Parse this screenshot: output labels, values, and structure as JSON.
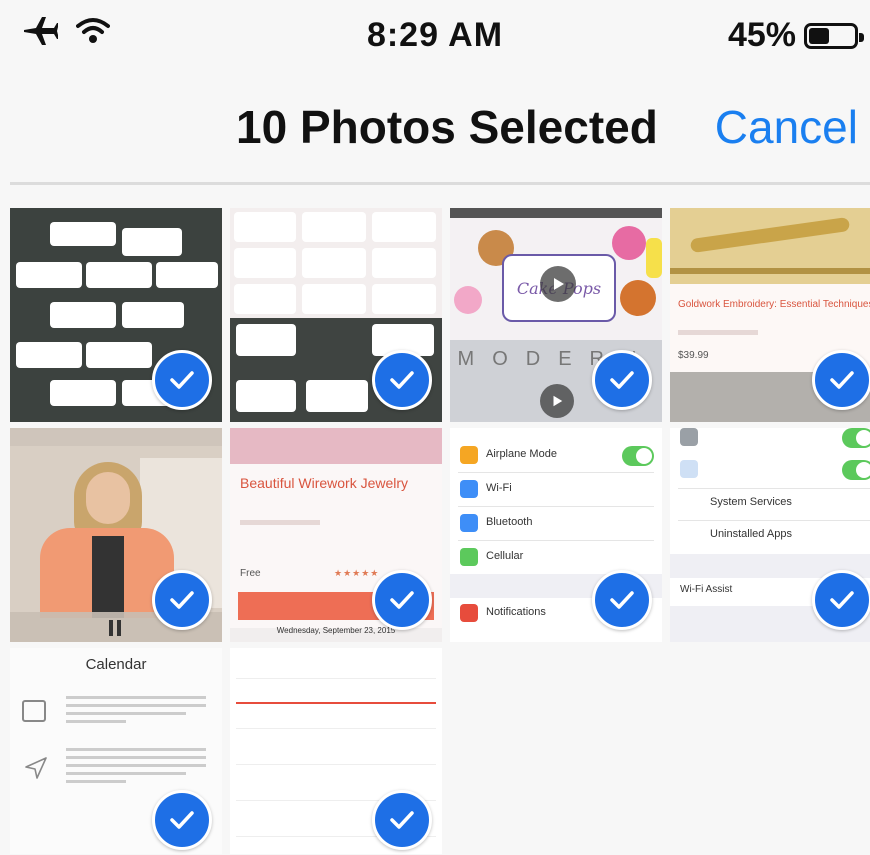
{
  "status_bar": {
    "time": "8:29 AM",
    "battery_percent": "45%",
    "battery_level": 0.45,
    "icons": [
      "airplane-icon",
      "wifi-icon",
      "battery-icon"
    ]
  },
  "nav": {
    "title": "10 Photos Selected",
    "cancel_label": "Cancel"
  },
  "colors": {
    "accent": "#1a7ff0",
    "check": "#1e6fe6"
  },
  "selected_count": 10,
  "thumbnails": [
    {
      "kind": "category-grid",
      "selected": true
    },
    {
      "kind": "category-grid",
      "selected": true
    },
    {
      "kind": "video-cake",
      "selected": true,
      "text": "Cake Pops",
      "subtext": "MODERN"
    },
    {
      "kind": "class",
      "selected": true,
      "title": "Goldwork Embroidery: Essential Techniques",
      "price": "$39.99"
    },
    {
      "kind": "video-person",
      "selected": true
    },
    {
      "kind": "class",
      "selected": true,
      "title": "Beautiful Wirework Jewelry",
      "price_label": "Free",
      "date": "Wednesday, September 23, 2015"
    },
    {
      "kind": "settings",
      "selected": true,
      "rows": [
        "Airplane Mode",
        "Wi-Fi",
        "Bluetooth",
        "Cellular",
        "Notifications"
      ]
    },
    {
      "kind": "settings",
      "selected": true,
      "rows": [
        "System Services",
        "Uninstalled Apps",
        "Wi-Fi Assist"
      ]
    },
    {
      "kind": "calendar",
      "selected": true,
      "title": "Calendar"
    },
    {
      "kind": "calendar-day",
      "selected": true
    }
  ]
}
